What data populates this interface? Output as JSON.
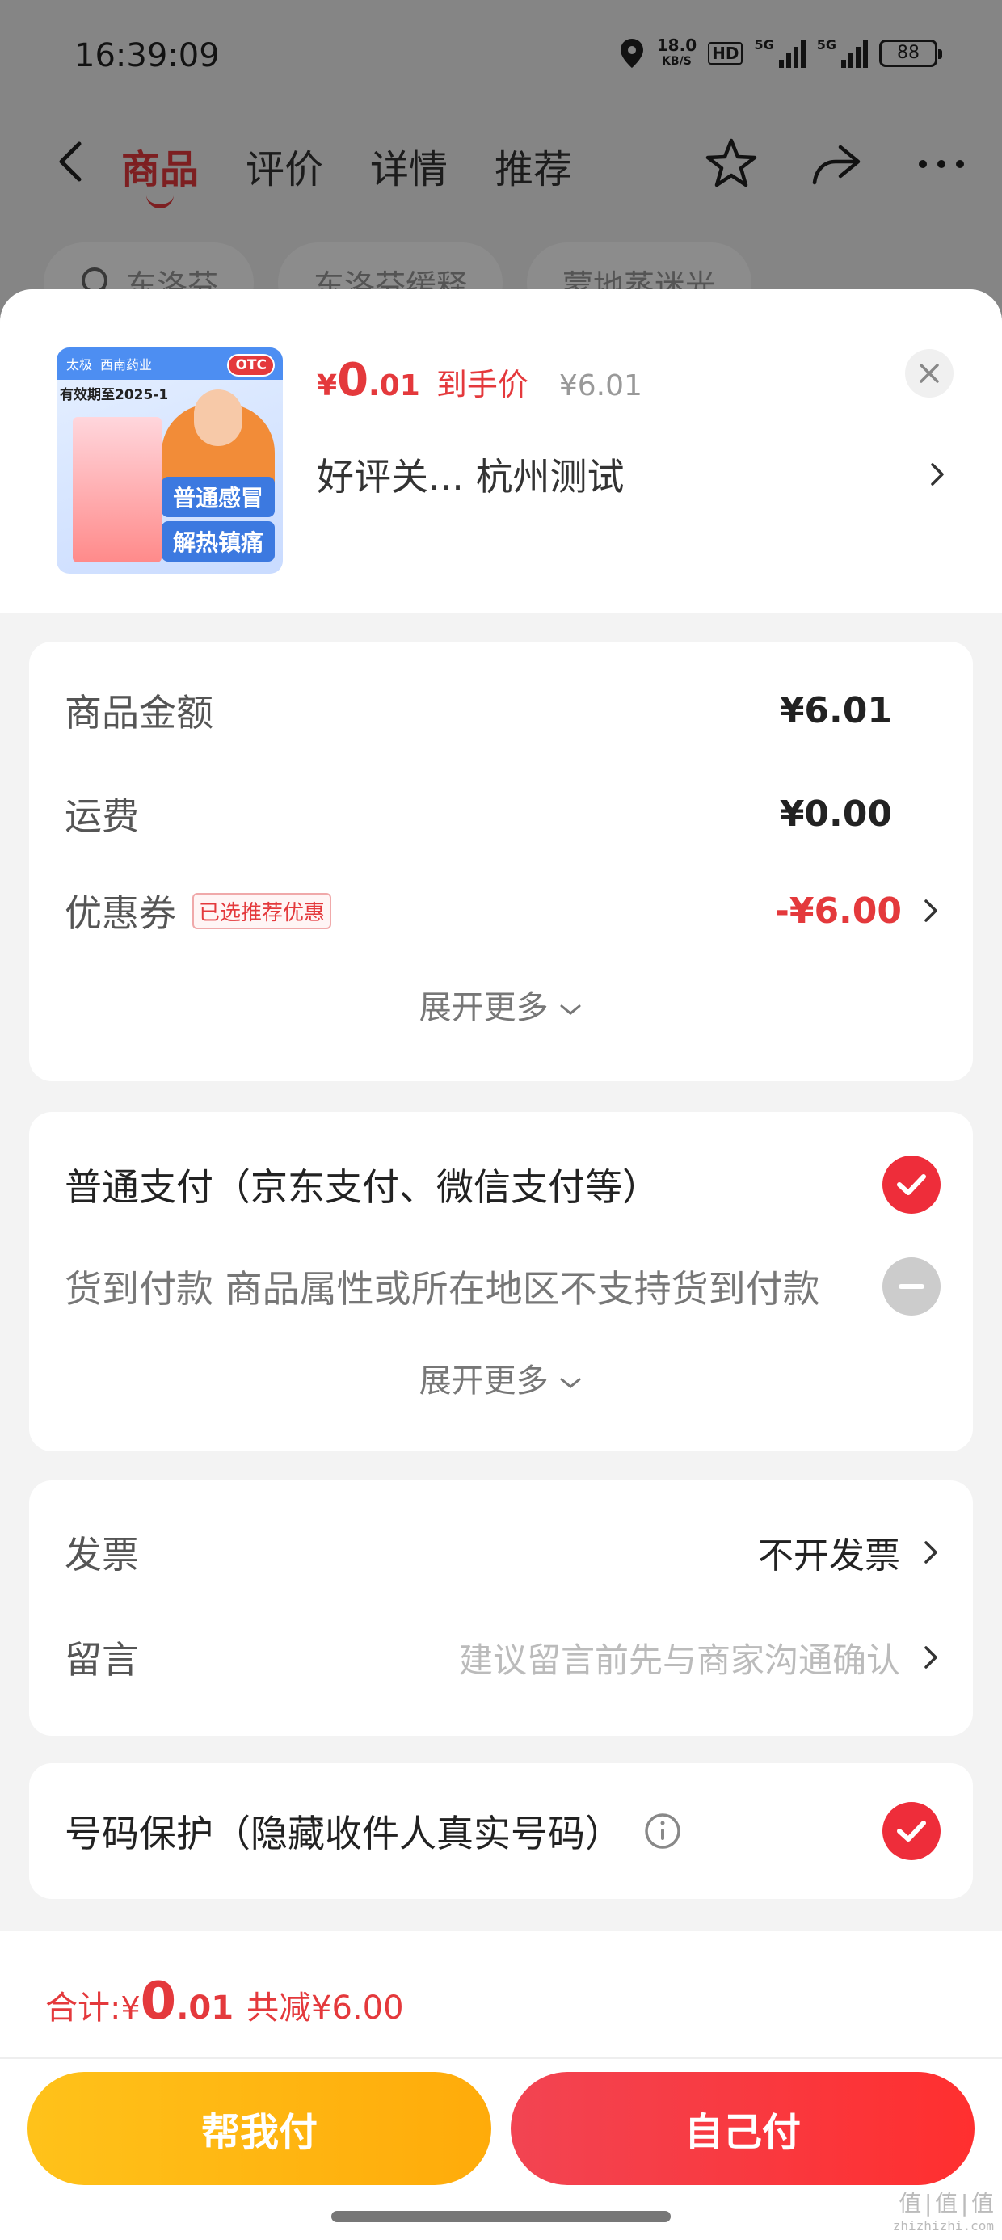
{
  "status_bar": {
    "time": "16:39:09",
    "net_speed_value": "18.0",
    "net_speed_unit": "KB/S",
    "hd_badge": "HD",
    "sig1_label": "5G",
    "sig2_label": "5G",
    "battery": "88"
  },
  "nav": {
    "tabs": [
      {
        "label": "商品",
        "active": true
      },
      {
        "label": "评价"
      },
      {
        "label": "详情"
      },
      {
        "label": "推荐"
      }
    ]
  },
  "search_chips": [
    "东洛芬",
    "东洛芬缓释",
    "蒙地蒸迷光"
  ],
  "product": {
    "thumb_brand": "太极",
    "thumb_brand2": "西南药业",
    "thumb_expiry": "有效期至2025-1",
    "thumb_otc": "OTC",
    "thumb_tag1": "普通感冒",
    "thumb_tag2": "解热镇痛",
    "price_symbol": "¥",
    "price_int": "0",
    "price_dec": ".01",
    "price_label": "到手价",
    "price_original": "¥6.01",
    "name": "好评关...  杭州测试"
  },
  "fees": {
    "goods_label": "商品金额",
    "goods_value": "¥6.01",
    "shipping_label": "运费",
    "shipping_value": "¥0.00",
    "coupon_label": "优惠券",
    "coupon_tag": "已选推荐优惠",
    "coupon_value": "-¥6.00",
    "expand_label": "展开更多"
  },
  "payment": {
    "normal_label": "普通支付（京东支付、微信支付等）",
    "cod_label": "货到付款  商品属性或所在地区不支持货到付款",
    "expand_label": "展开更多"
  },
  "invoice": {
    "invoice_label": "发票",
    "invoice_value": "不开发票",
    "note_label": "留言",
    "note_placeholder": "建议留言前先与商家沟通确认"
  },
  "protect": {
    "label": "号码保护（隐藏收件人真实号码）"
  },
  "footer": {
    "total_label": "合计: ",
    "total_symbol": "¥",
    "total_int": "0",
    "total_dec": ".01",
    "total_save": "共减¥6.00",
    "help_pay": "帮我付",
    "self_pay": "自己付"
  },
  "watermark": {
    "main": "值|值|值",
    "sub": "zhizhizhi.com"
  },
  "colors": {
    "accent_red": "#e4393c",
    "help_btn": "#ffb612",
    "self_btn": "#f33a42"
  }
}
